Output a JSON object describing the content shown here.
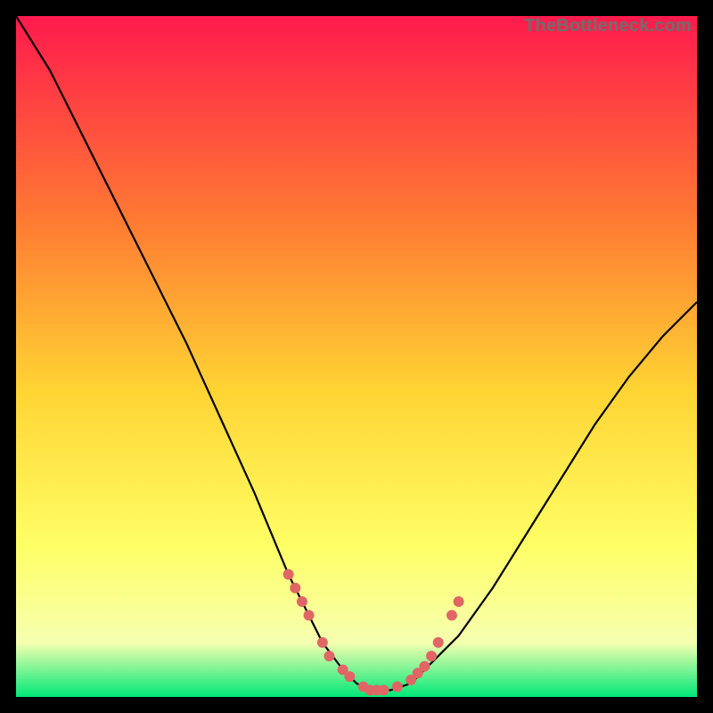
{
  "watermark": "TheBottleneck.com",
  "colors": {
    "bg": "#000000",
    "grad_top": "#ff1a4d",
    "grad_mid1": "#ff7a33",
    "grad_mid2": "#ffd433",
    "grad_mid3": "#ffff66",
    "grad_low": "#f6ffb0",
    "grad_bottom": "#00e878",
    "curve": "#000000",
    "dots": "#e06666"
  },
  "chart_data": {
    "type": "line",
    "title": "",
    "xlabel": "",
    "ylabel": "",
    "xlim": [
      0,
      100
    ],
    "ylim": [
      0,
      100
    ],
    "series": [
      {
        "name": "bottleneck-curve",
        "x": [
          0,
          5,
          10,
          15,
          20,
          25,
          30,
          35,
          40,
          42,
          45,
          48,
          50,
          52,
          55,
          58,
          60,
          65,
          70,
          75,
          80,
          85,
          90,
          95,
          100
        ],
        "y": [
          100,
          92,
          82,
          72,
          62,
          52,
          41,
          30,
          18,
          14,
          8,
          4,
          2,
          1,
          1,
          2,
          4,
          9,
          16,
          24,
          32,
          40,
          47,
          53,
          58
        ]
      }
    ],
    "highlight_points": {
      "name": "optimal-range-dots",
      "x": [
        40,
        41,
        42,
        43,
        45,
        46,
        48,
        49,
        51,
        52,
        53,
        54,
        56,
        58,
        59,
        60,
        61,
        62,
        64,
        65
      ],
      "y": [
        18,
        16,
        14,
        12,
        8,
        6,
        4,
        3,
        1.5,
        1,
        1,
        1,
        1.5,
        2.5,
        3.5,
        4.5,
        6,
        8,
        12,
        14
      ]
    }
  }
}
